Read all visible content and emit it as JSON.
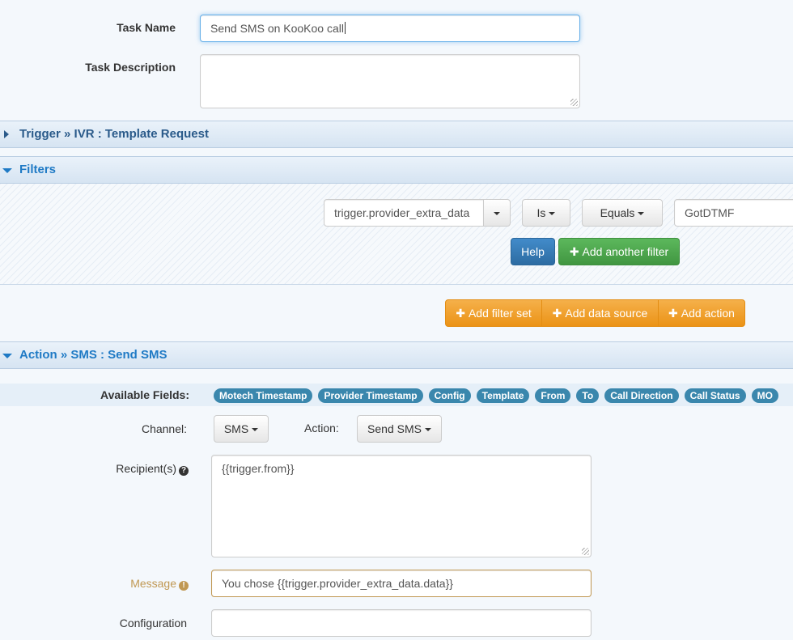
{
  "task": {
    "name_label": "Task Name",
    "name_value": "Send SMS on KooKoo call",
    "description_label": "Task Description",
    "description_value": ""
  },
  "trigger_section": {
    "title": "Trigger » IVR : Template Request"
  },
  "filters_section": {
    "title": "Filters",
    "field_value": "trigger.provider_extra_data",
    "operator_label": "Is",
    "comparison_label": "Equals",
    "filter_value": "GotDTMF",
    "help_label": "Help",
    "add_filter_label": "Add another filter"
  },
  "set_actions": {
    "add_filter_set": "Add filter set",
    "add_data_source": "Add data source",
    "add_action": "Add action"
  },
  "action_section": {
    "title": "Action » SMS : Send SMS",
    "available_fields_label": "Available Fields:",
    "available_fields": [
      "Motech Timestamp",
      "Provider Timestamp",
      "Config",
      "Template",
      "From",
      "To",
      "Call Direction",
      "Call Status",
      "MO"
    ],
    "channel_label": "Channel:",
    "channel_value": "SMS",
    "action_label": "Action:",
    "action_value": "Send SMS",
    "recipients_label": "Recipient(s)",
    "recipients_value": "{{trigger.from}}",
    "message_label": "Message",
    "message_value": "You chose {{trigger.provider_extra_data.data}}",
    "configuration_label": "Configuration",
    "configuration_value": ""
  },
  "colors": {
    "section_blue": "#1f7ac5",
    "label_pill": "#3a87ad",
    "warning_label": "#c09853"
  }
}
